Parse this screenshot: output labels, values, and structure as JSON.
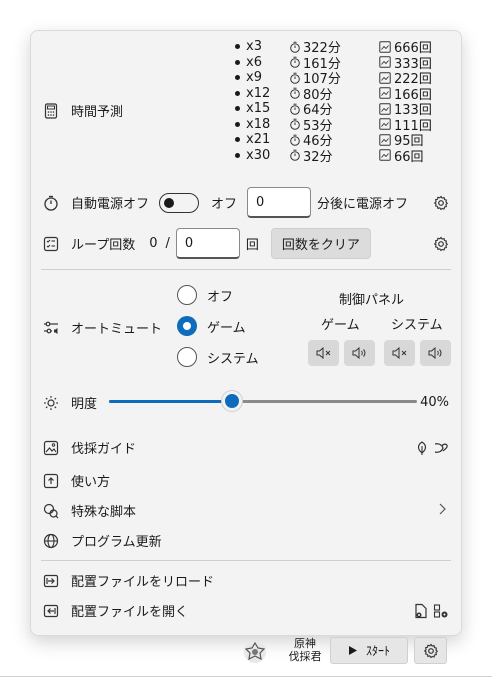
{
  "estimate": {
    "label": "時間予測",
    "rows": [
      {
        "mult": "x3",
        "minutes": "322分",
        "count": "666回"
      },
      {
        "mult": "x6",
        "minutes": "161分",
        "count": "333回"
      },
      {
        "mult": "x9",
        "minutes": "107分",
        "count": "222回"
      },
      {
        "mult": "x12",
        "minutes": "80分",
        "count": "166回"
      },
      {
        "mult": "x15",
        "minutes": "64分",
        "count": "133回"
      },
      {
        "mult": "x18",
        "minutes": "53分",
        "count": "111回"
      },
      {
        "mult": "x21",
        "minutes": "46分",
        "count": "95回"
      },
      {
        "mult": "x30",
        "minutes": "32分",
        "count": "66回"
      }
    ]
  },
  "auto_power": {
    "label": "自動電源オフ",
    "state": "オフ",
    "minutes_value": "0",
    "suffix": "分後に電源オフ"
  },
  "loop": {
    "label": "ループ回数",
    "current": "0",
    "slash": "/",
    "total_value": "0",
    "unit": "回",
    "clear_label": "回数をクリア"
  },
  "auto_mute": {
    "label": "オートミュート",
    "options": [
      "オフ",
      "ゲーム",
      "システム"
    ],
    "selected": "ゲーム",
    "panel_title": "制御パネル",
    "panel_game": "ゲーム",
    "panel_system": "システム"
  },
  "brightness": {
    "label": "明度",
    "value_text": "40%",
    "value": 0.4
  },
  "menu": {
    "guide": "伐採ガイド",
    "usage": "使い方",
    "scripts": "特殊な脚本",
    "update": "プログラム更新",
    "reload_config": "配置ファイルをリロード",
    "open_config": "配置ファイルを開く"
  },
  "taskbar": {
    "app_name_line1": "原神",
    "app_name_line2": "伐採君",
    "start_label": "ｽﾀｰﾄ"
  },
  "colors": {
    "accent": "#0f6cbd",
    "menu_bg": "#f3f3f3"
  }
}
